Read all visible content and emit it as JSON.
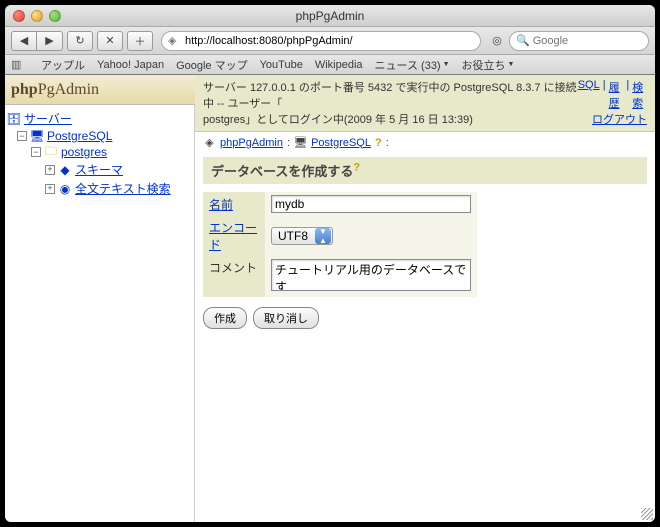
{
  "window": {
    "title": "phpPgAdmin"
  },
  "toolbar": {
    "url": "http://localhost:8080/phpPgAdmin/",
    "search_placeholder": "Google"
  },
  "bookmarks": {
    "items": [
      "アップル",
      "Yahoo! Japan",
      "Google マップ",
      "YouTube",
      "Wikipedia",
      "ニュース (33)",
      "お役立ち"
    ]
  },
  "logo": {
    "php": "php",
    "pg": "Pg",
    "admin": "Admin"
  },
  "tree": {
    "root": "サーバー",
    "db_server": "PostgreSQL",
    "database": "postgres",
    "schema": "スキーマ",
    "fts": "全文テキスト検索"
  },
  "banner": {
    "line1_a": "サーバー 127.0.0.1 のポート番号 5432 で実行中の PostgreSQL 8.3.7 に接続中 -- ユーザー「",
    "line1_b": "postgres",
    "line1_c": "」としてログイン中(2009 年 5 月 16 日 13:39)",
    "sql": "SQL",
    "history": "履歴",
    "search": "検索",
    "logout": "ログアウト"
  },
  "breadcrumb": {
    "root": "phpPgAdmin",
    "sep": ":",
    "server": "PostgreSQL"
  },
  "heading": "データベースを作成する",
  "form": {
    "name_label": "名前",
    "name_value": "mydb",
    "encoding_label": "エンコード",
    "encoding_value": "UTF8",
    "comment_label": "コメント",
    "comment_value": "チュートリアル用のデータベースです",
    "submit": "作成",
    "cancel": "取り消し"
  }
}
